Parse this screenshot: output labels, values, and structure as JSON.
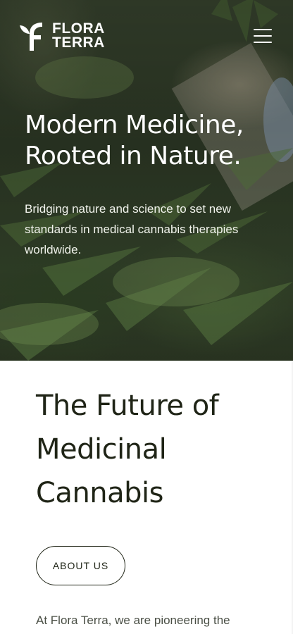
{
  "header": {
    "logo": {
      "line1": "FLORA",
      "line2": "TERRA",
      "icon": "leaf-f-logo-icon"
    },
    "menu_icon": "hamburger-menu-icon"
  },
  "hero": {
    "title_line1": "Modern Medicine,",
    "title_line2": "Rooted in Nature.",
    "subtitle": "Bridging nature and science to set new standards in medical cannabis therapies worldwide."
  },
  "section": {
    "title_line1": "The Future of",
    "title_line2": "Medicinal",
    "title_line3": "Cannabis",
    "button_label": "ABOUT US",
    "intro_text": "At Flora Terra, we are pioneering the"
  },
  "colors": {
    "text_dark": "#1f2416",
    "hero_overlay": "#2f3b27",
    "white": "#ffffff"
  }
}
